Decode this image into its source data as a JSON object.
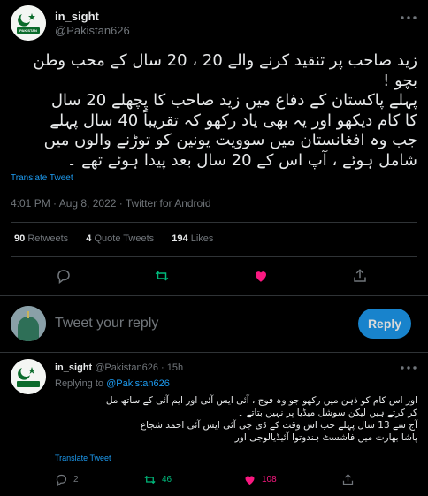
{
  "main_tweet": {
    "display_name": "in_sight",
    "handle": "@Pakistan626",
    "avatar_badge_text": "PAKISTAN",
    "text_lines": [
      "زید صاحب پر تنقید کرنے والے 20 ، 20 سال کے محب وطن",
      "بچو !",
      "پہلے پاکستان کے دفاع میں زید صاحب کا پچھلے 20 سال",
      "کا کام دیکھو اور یہ بھی یاد رکھو کہ تقریباً 40 سال پہلے",
      "جب وہ افغانستان میں سوویت یونین کو توڑنے والوں میں",
      "شامل ہوئے ، آپ اس کے 20 سال بعد پیدا ہوئے تھے ۔"
    ],
    "translate_label": "Translate Tweet",
    "meta": "4:01 PM · Aug 8, 2022 · Twitter for Android",
    "retweets_count": "90",
    "retweets_label": "Retweets",
    "quotes_count": "4",
    "quotes_label": "Quote Tweets",
    "likes_count": "194",
    "likes_label": "Likes"
  },
  "composer": {
    "placeholder": "Tweet your reply",
    "button_label": "Reply"
  },
  "reply_tweet": {
    "display_name": "in_sight",
    "handle": "@Pakistan626",
    "time": "· 15h",
    "replying_prefix": "Replying to",
    "replying_to": "@Pakistan626",
    "text_lines": [
      "اور اس کام کو ذہن میں رکھو جو وہ فوج ، آئی ایس آئی اور ایم آئی کے ساتھ مل",
      "کر کرتے ہیں لیکن سوشل میڈیا پر نہیں بتاتے ۔",
      "آج سے 13 سال پہلے جب اس وقت کے ڈی جی آئی ایس آئی احمد شجاع",
      "پاشا بھارت میں فاشسٹ ہندوتوا آئیڈیالوجی اور"
    ],
    "translate_label": "Translate Tweet",
    "reply_count": "2",
    "retweet_count": "46",
    "like_count": "108"
  },
  "colors": {
    "background": "#000000",
    "text": "#e7e9ea",
    "muted": "#71767b",
    "accent": "#1d9bf0",
    "retweet_green": "#00ba7c",
    "like_pink": "#f91880",
    "divider": "#2f3336"
  }
}
